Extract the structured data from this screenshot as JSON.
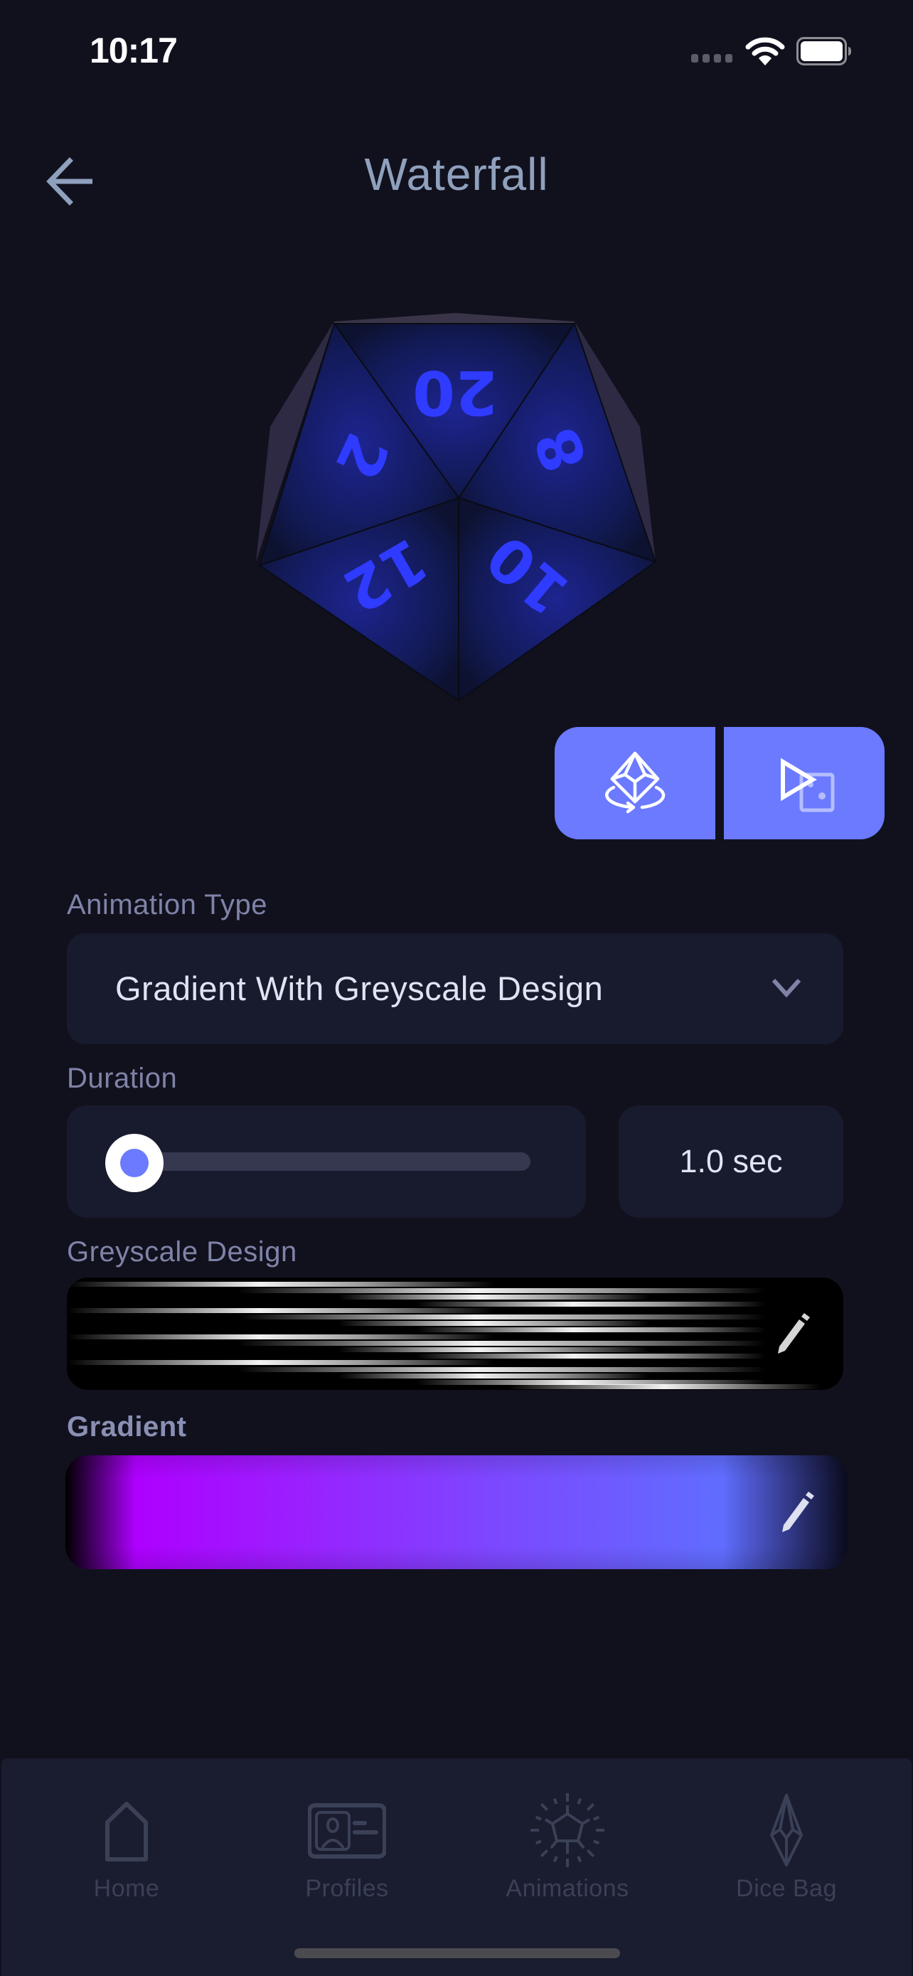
{
  "status_bar": {
    "time": "10:17",
    "icons": [
      "signal-icon",
      "wifi-icon",
      "battery-icon"
    ]
  },
  "header": {
    "title": "Waterfall",
    "back_icon": "arrow-left-icon"
  },
  "die_preview": {
    "type": "d20",
    "visible_numbers": [
      "20",
      "2",
      "8",
      "12",
      "10"
    ],
    "color": "#2a2fff"
  },
  "actions": [
    {
      "name": "rotate-3d-preview",
      "icon": "rotate-die-icon"
    },
    {
      "name": "play-on-die",
      "icon": "play-die-icon"
    }
  ],
  "animation_type": {
    "label": "Animation Type",
    "selected": "Gradient With Greyscale Design"
  },
  "duration": {
    "label": "Duration",
    "value_text": "1.0 sec",
    "slider_fraction": 0.0
  },
  "greyscale_design": {
    "label": "Greyscale Design",
    "edit_icon": "pencil-icon"
  },
  "gradient": {
    "label": "Gradient",
    "edit_icon": "pencil-icon",
    "stops": [
      "#000000",
      "#ae00ff",
      "#9a20ff",
      "#7c48ff",
      "#606dff",
      "#0a0b1e"
    ]
  },
  "colors": {
    "background": "#11111e",
    "accent": "#6b7aff",
    "card": "#181a2e",
    "label": "#7f83a7",
    "tab_inactive": "#3a4157"
  },
  "tabbar": {
    "items": [
      {
        "label": "Home",
        "icon": "home-icon"
      },
      {
        "label": "Profiles",
        "icon": "profile-card-icon"
      },
      {
        "label": "Animations",
        "icon": "animations-icon"
      },
      {
        "label": "Dice Bag",
        "icon": "dice-bag-icon"
      }
    ]
  }
}
